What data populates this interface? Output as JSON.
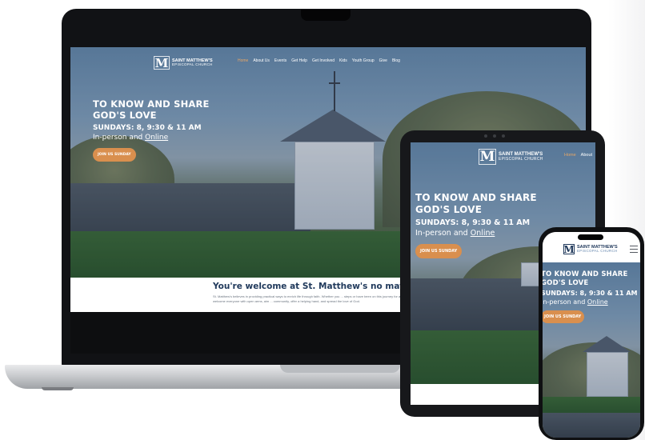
{
  "site": {
    "logo_line1": "SAINT MATTHEW'S",
    "logo_line2": "EPISCOPAL CHURCH",
    "logo_mark": "M",
    "nav": [
      "Home",
      "About Us",
      "Events",
      "Get Help",
      "Get Involved",
      "Kids",
      "Youth Group",
      "Give",
      "Blog"
    ],
    "tablet_nav": [
      "Home",
      "About"
    ],
    "hero": {
      "title_line1": "TO KNOW AND SHARE",
      "title_line2": "GOD'S LOVE",
      "times": "SUNDAYS: 8, 9:30 & 11 AM",
      "attend_prefix": "In-person and ",
      "attend_link": "Online",
      "cta": "JOIN US SUNDAY"
    },
    "phone_hero": {
      "title_line1": "TO KNOW AND SHARE",
      "title_line2": "GOD'S LOVE",
      "times": "SUNDAYS: 8, 9:30 & 11 AM",
      "attend_prefix": "In-person and ",
      "attend_link": "Online",
      "cta": "JOIN US SUNDAY"
    },
    "welcome": {
      "title": "You're welcome at St. Matthew's no matter what",
      "body": "St. Matthew's believes in providing practical ways to enrich life through faith. Whether you ... steps or have been on this journey for a while, we welcome everyone with open arms, aim ... community, offer a helping hand, and spread the love of God."
    }
  },
  "colors": {
    "accent_orange": "#d98f4e",
    "heading_navy": "#213a5c",
    "nav_active": "#e8a766",
    "device_frame": "#111215"
  },
  "icons": {
    "menu": "hamburger-icon",
    "logo": "church-logo-icon"
  }
}
